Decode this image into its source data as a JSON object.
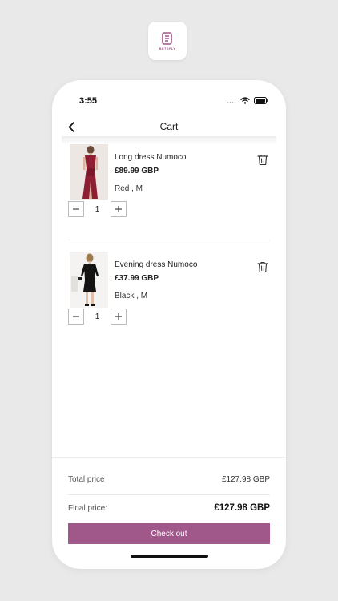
{
  "status_bar": {
    "time": "3:55",
    "signal_dots": "....",
    "icons": [
      "wifi-icon",
      "battery-icon"
    ]
  },
  "app_logo": {
    "brand": "BETSFLY",
    "icon": "app-logo-icon",
    "color": "#a0578a"
  },
  "nav": {
    "title": "Cart",
    "back_icon": "chevron-left-icon"
  },
  "cart": {
    "items": [
      {
        "name": "Long dress Numoco",
        "price": "£89.99 GBP",
        "variant": "Red , M",
        "quantity": "1",
        "image_color": "#8e1f33",
        "delete_icon": "trash-icon"
      },
      {
        "name": "Evening dress Numoco",
        "price": "£37.99 GBP",
        "variant": "Black , M",
        "quantity": "1",
        "image_color": "#111111",
        "delete_icon": "trash-icon"
      }
    ]
  },
  "summary": {
    "total_label": "Total price",
    "total_value": "£127.98 GBP",
    "final_label": "Final price:",
    "final_value": "£127.98 GBP"
  },
  "checkout": {
    "label": "Check out",
    "color": "#a0578a"
  }
}
